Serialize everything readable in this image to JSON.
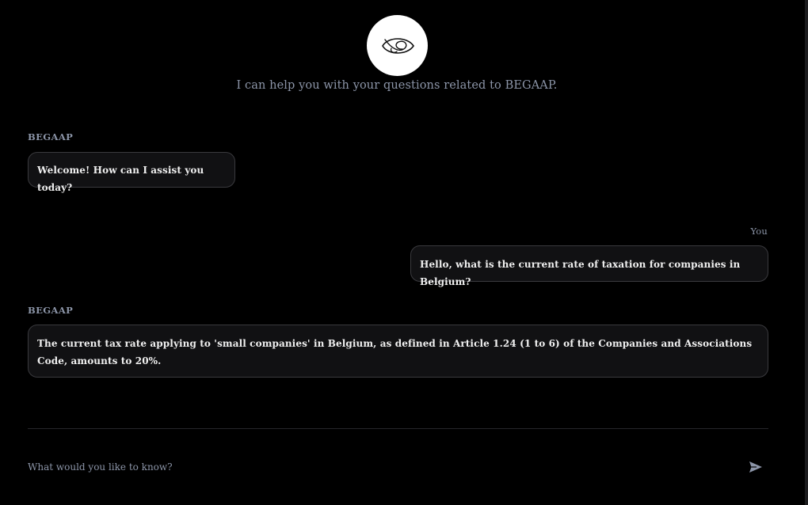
{
  "header": {
    "logo_icon": "eye-swirl-logo",
    "intro": "I can help you with your questions related to BEGAAP."
  },
  "chat": {
    "messages": [
      {
        "sender": "BEGAAP",
        "text": "Welcome! How can I assist you today?"
      },
      {
        "sender": "You",
        "text": "Hello, what is the current rate of taxation for companies in Belgium?"
      },
      {
        "sender": "BEGAAP",
        "text": "The current tax rate applying to 'small companies' in Belgium, as defined in Article 1.24 (1 to 6) of the Companies and Associations Code, amounts to 20%."
      }
    ]
  },
  "composer": {
    "placeholder": "What would you like to know?",
    "send_icon": "send-arrow-icon"
  },
  "colors": {
    "background": "#000000",
    "bubble": "#111113",
    "bubble_border": "#3a3a3e",
    "muted_text": "#8c95a8",
    "message_text": "#f0f0f0",
    "logo_background": "#ffffff"
  }
}
